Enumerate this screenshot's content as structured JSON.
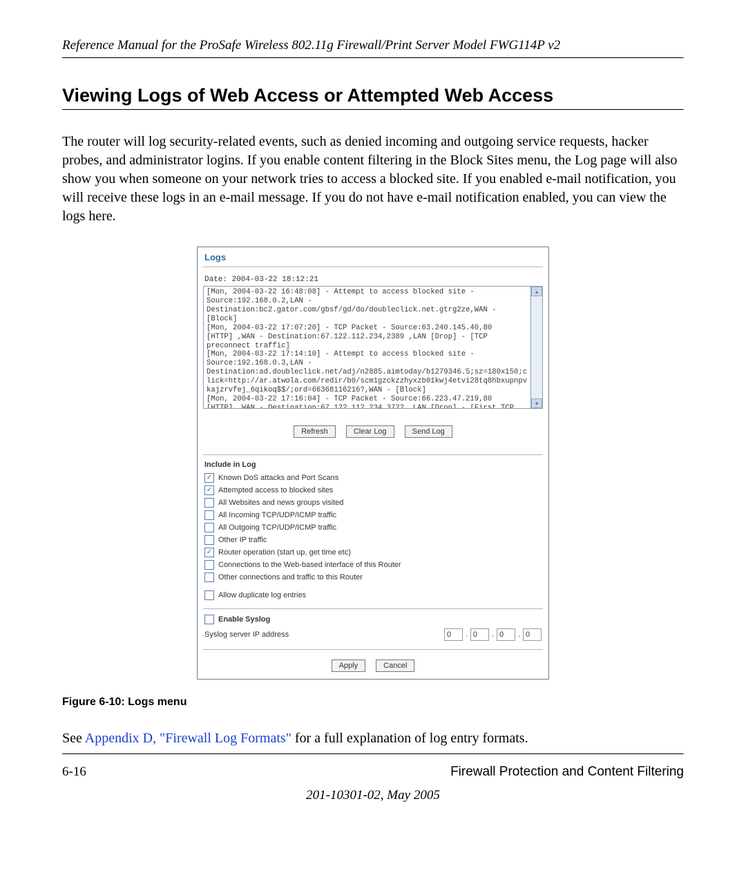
{
  "header": "Reference Manual for the ProSafe Wireless 802.11g  Firewall/Print Server Model FWG114P v2",
  "section_title": "Viewing Logs of Web Access or Attempted Web Access",
  "body_para": "The router will log security-related events, such as denied incoming and outgoing service requests, hacker probes, and administrator logins. If you enable content filtering in the Block Sites menu, the Log page will also show you when someone on your network tries to access a blocked site. If you enabled e-mail notification, you will receive these logs in an e-mail message. If you do not have e-mail notification enabled, you can view the logs here.",
  "screenshot": {
    "title": "Logs",
    "date_line": "Date: 2004-03-22 18:12:21",
    "log_text": "[Mon, 2004-03-22 16:48:08] - Attempt to access blocked site -\nSource:192.168.0.2,LAN -\nDestination:bc2.gator.com/gbsf/gd/do/doubleclick.net.gtrg2ze,WAN -\n[Block]\n[Mon, 2004-03-22 17:07:20] - TCP Packet - Source:63.240.145.40,80\n[HTTP] ,WAN - Destination:67.122.112.234,2389 ,LAN [Drop] - [TCP\npreconnect traffic]\n[Mon, 2004-03-22 17:14:10] - Attempt to access blocked site -\nSource:192.168.0.3,LAN -\nDestination:ad.doubleclick.net/adj/n2885.aimtoday/b1279346.5;sz=180x150;c\nlick=http://ar.atwola.com/redir/b0/scm1gzckzzhyxzb01kwj4etvi28tq8hbxupnpv\nkajzrvfej_6qikoq$$/;ord=66368116216?,WAN - [Block]\n[Mon, 2004-03-22 17:16:04] - TCP Packet - Source:66.223.47.219,80\n[HTTP] ,WAN - Destination:67.122.112.234,3722 ,LAN [Drop] - [First TCP\nPacket not SYN]",
    "buttons": {
      "refresh": "Refresh",
      "clear": "Clear Log",
      "send": "Send Log"
    },
    "include_head": "Include in Log",
    "include_items": [
      {
        "label": "Known DoS attacks and Port Scans",
        "checked": true
      },
      {
        "label": "Attempted access to blocked sites",
        "checked": true
      },
      {
        "label": "All Websites and news groups visited",
        "checked": false
      },
      {
        "label": "All Incoming TCP/UDP/ICMP traffic",
        "checked": false
      },
      {
        "label": "All Outgoing TCP/UDP/ICMP traffic",
        "checked": false
      },
      {
        "label": "Other IP traffic",
        "checked": false
      },
      {
        "label": "Router operation (start up, get time etc)",
        "checked": true
      },
      {
        "label": "Connections to the Web-based interface of this Router",
        "checked": false
      },
      {
        "label": "Other connections and traffic to this Router",
        "checked": false
      }
    ],
    "allow_dup": {
      "label": "Allow duplicate log entries",
      "checked": false
    },
    "syslog": {
      "enable_label": "Enable Syslog",
      "enable_checked": false,
      "ip_label": "Syslog server IP address",
      "ip": [
        "0",
        "0",
        "0",
        "0"
      ]
    },
    "bottom_buttons": {
      "apply": "Apply",
      "cancel": "Cancel"
    }
  },
  "figure_caption": "Figure 6-10:  Logs menu",
  "see_text": {
    "pre": "See ",
    "link": "Appendix D, \"Firewall Log Formats\"",
    "post": " for a full explanation of log entry formats."
  },
  "footer": {
    "page": "6-16",
    "section": "Firewall Protection and Content Filtering",
    "docnum": "201-10301-02, May 2005"
  }
}
